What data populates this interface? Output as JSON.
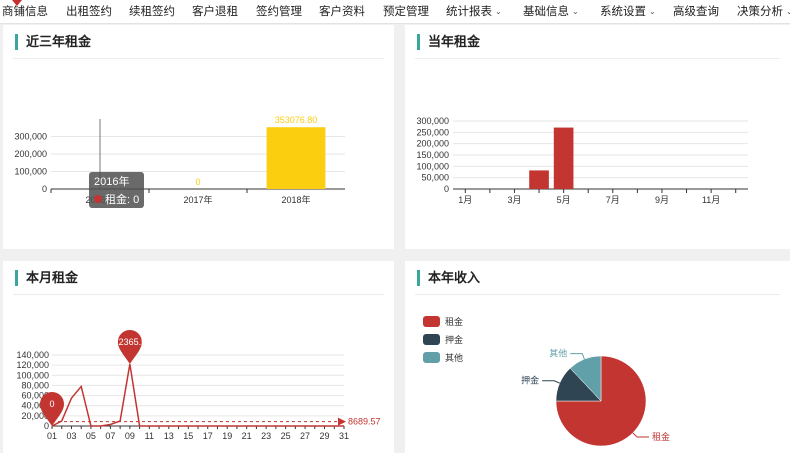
{
  "nav": {
    "items": [
      {
        "label": "商铺信息",
        "caret": false
      },
      {
        "label": "出租签约",
        "caret": false
      },
      {
        "label": "续租签约",
        "caret": false
      },
      {
        "label": "客户退租",
        "caret": false
      },
      {
        "label": "签约管理",
        "caret": false
      },
      {
        "label": "客户资料",
        "caret": false
      },
      {
        "label": "预定管理",
        "caret": false
      },
      {
        "label": "统计报表",
        "caret": true
      },
      {
        "label": "基础信息",
        "caret": true
      },
      {
        "label": "系统设置",
        "caret": true
      },
      {
        "label": "高级查询",
        "caret": false
      },
      {
        "label": "决策分析",
        "caret": true
      }
    ],
    "caret_glyph": "⌄"
  },
  "panels": {
    "p1": {
      "title": "近三年租金"
    },
    "p2": {
      "title": "当年租金"
    },
    "p3": {
      "title": "本月租金"
    },
    "p4": {
      "title": "本年收入"
    }
  },
  "colors": {
    "accent": "#3aa79c",
    "red": "#c23531",
    "yellow": "#fbce10",
    "navy": "#2f4554",
    "teal": "#61a0a8"
  },
  "chart_data": [
    {
      "type": "bar",
      "title": "近三年租金",
      "categories": [
        "2016年",
        "2017年",
        "2018年"
      ],
      "values": [
        0,
        0,
        353076.8
      ],
      "data_labels": [
        "0",
        "0",
        "353076.80"
      ],
      "ytick_labels": [
        "0",
        "100,000",
        "200,000",
        "300,000"
      ],
      "ylim": [
        0,
        400000
      ],
      "grid": true,
      "tooltip": {
        "title": "2016年",
        "series": "租金",
        "value": "0"
      }
    },
    {
      "type": "bar",
      "title": "当年租金",
      "categories": [
        "1月",
        "2月",
        "3月",
        "4月",
        "5月",
        "6月",
        "7月",
        "8月",
        "9月",
        "10月",
        "11月",
        "12月"
      ],
      "tick_labels": [
        "1月",
        "3月",
        "5月",
        "7月",
        "9月",
        "11月"
      ],
      "values": [
        0,
        0,
        0,
        82000,
        271000,
        0,
        0,
        0,
        0,
        0,
        0,
        0
      ],
      "ytick_labels": [
        "0",
        "50,000",
        "100,000",
        "150,000",
        "200,000",
        "250,000",
        "300,000"
      ],
      "ylim": [
        0,
        300000
      ],
      "grid": true
    },
    {
      "type": "line",
      "title": "本月租金",
      "x": [
        "01",
        "02",
        "03",
        "04",
        "05",
        "06",
        "07",
        "08",
        "09",
        "10",
        "11",
        "12",
        "13",
        "14",
        "15",
        "16",
        "17",
        "18",
        "19",
        "20",
        "21",
        "22",
        "23",
        "24",
        "25",
        "26",
        "27",
        "28",
        "29",
        "30",
        "31"
      ],
      "tick_labels": [
        "01",
        "03",
        "05",
        "07",
        "09",
        "11",
        "13",
        "15",
        "17",
        "19",
        "21",
        "23",
        "25",
        "27",
        "29",
        "31"
      ],
      "values": [
        0,
        10000,
        55000,
        78000,
        0,
        0,
        3000,
        10000,
        122365.57,
        0,
        0,
        0,
        0,
        0,
        0,
        0,
        0,
        0,
        0,
        0,
        0,
        0,
        0,
        0,
        0,
        0,
        0,
        0,
        0,
        0,
        0
      ],
      "ytick_labels": [
        "0",
        "20,000",
        "40,000",
        "60,000",
        "80,000",
        "100,000",
        "120,000",
        "140,000"
      ],
      "ylim": [
        0,
        140000
      ],
      "grid": true,
      "markpoints": [
        {
          "label": "0",
          "x": "01",
          "value": 0
        },
        {
          "label": "122365.57",
          "x": "09",
          "value": 122365.57
        }
      ],
      "markline": {
        "label": "8689.57",
        "value": 8689.57
      }
    },
    {
      "type": "pie",
      "title": "本年收入",
      "legend": [
        "租金",
        "押金",
        "其他"
      ],
      "legend_position": "top-left",
      "slices": [
        {
          "name": "租金",
          "value": 75
        },
        {
          "name": "押金",
          "value": 13
        },
        {
          "name": "其他",
          "value": 12
        }
      ]
    }
  ]
}
